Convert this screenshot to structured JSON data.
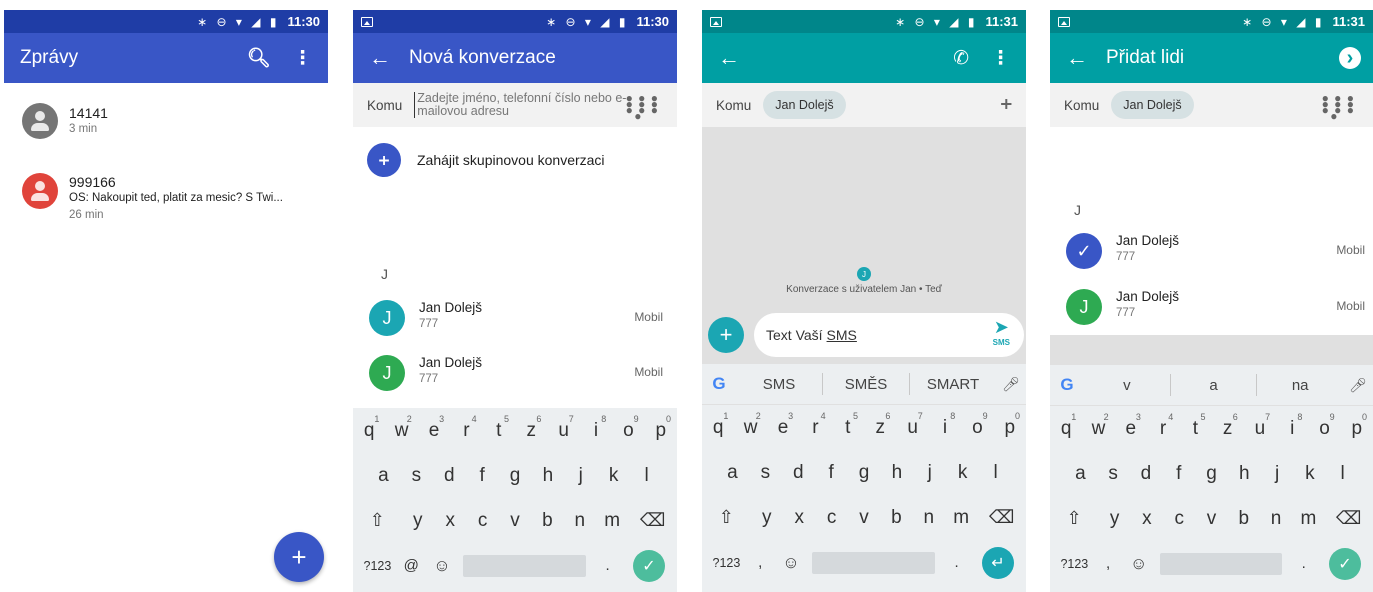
{
  "status": {
    "time1": "11:30",
    "time2": "11:30",
    "time3": "11:31",
    "time4": "11:31",
    "icons": "∗ ⊖ ▾ ◢ ▮"
  },
  "screen1": {
    "title": "Zprávy",
    "conversations": [
      {
        "name": "14141",
        "preview": "",
        "time": "3 min",
        "color": "#757575"
      },
      {
        "name": "999166",
        "preview": "OS: Nakoupit ted, platit za mesic? S Twi...",
        "time": "26 min",
        "color": "#e0443b"
      }
    ],
    "fab": "+"
  },
  "screen2": {
    "title": "Nová konverzace",
    "to_label": "Komu",
    "placeholder": "Zadejte jméno, telefonní číslo nebo e-mailovou adresu",
    "group_label": "Zahájit skupinovou konverzaci",
    "letter": "J",
    "contacts": [
      {
        "initial": "J",
        "name": "Jan Dolejš",
        "number": "777",
        "type": "Mobil",
        "color": "#1ba6b3"
      },
      {
        "initial": "J",
        "name": "Jan Dolejš",
        "number": "777",
        "type": "Mobil",
        "color": "#2eaa52"
      }
    ]
  },
  "screen3": {
    "to_label": "Komu",
    "chip": "Jan Dolejš",
    "avatar_initial": "J",
    "note": "Konverzace s uživatelem Jan • Teď",
    "message_prefix": "Text Vaší",
    "message_sms": "SMS",
    "send_label": "SMS",
    "suggestions": [
      "SMS",
      "SMĚS",
      "SMART"
    ]
  },
  "screen4": {
    "title": "Přidat lidi",
    "to_label": "Komu",
    "chip": "Jan Dolejš",
    "letter": "J",
    "contacts": [
      {
        "initial": "✓",
        "name": "Jan Dolejš",
        "number": "777",
        "type": "Mobil",
        "color": "#3956c6"
      },
      {
        "initial": "J",
        "name": "Jan Dolejš",
        "number": "777",
        "type": "Mobil",
        "color": "#2eaa52"
      }
    ],
    "suggestions": [
      "v",
      "a",
      "na"
    ]
  },
  "keyboard": {
    "row1": [
      "q",
      "w",
      "e",
      "r",
      "t",
      "z",
      "u",
      "i",
      "o",
      "p"
    ],
    "row1_nums": [
      "1",
      "2",
      "3",
      "4",
      "5",
      "6",
      "7",
      "8",
      "9",
      "0"
    ],
    "row2": [
      "a",
      "s",
      "d",
      "f",
      "g",
      "h",
      "j",
      "k",
      "l"
    ],
    "row3": [
      "y",
      "x",
      "c",
      "v",
      "b",
      "n",
      "m"
    ],
    "shift": "⇧",
    "backspace": "⌫",
    "sym": "?123",
    "at": "@",
    "comma": ",",
    "emoji": "☺",
    "period": ".",
    "check": "✓",
    "enter": "↵"
  },
  "icons": {
    "g_logo": "G",
    "mic": "🎤",
    "dialpad": "⠿",
    "add_person": "⁺👥",
    "search": "⚲",
    "more": "⋮",
    "back": "←",
    "phone": "✆",
    "next": "›"
  }
}
